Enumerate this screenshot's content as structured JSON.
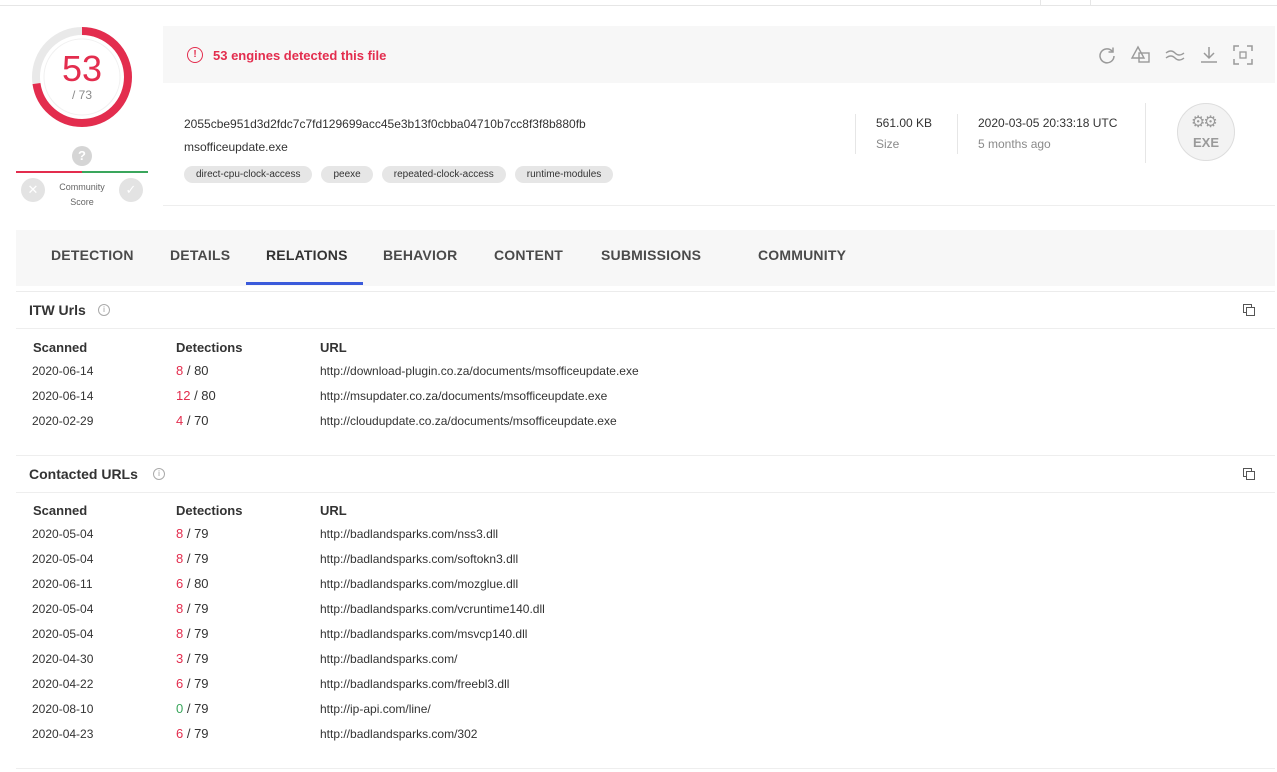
{
  "score": {
    "detected": "53",
    "total": "/ 73",
    "ring_fraction": 0.726,
    "color": "#e32d4e"
  },
  "community": {
    "question": "?",
    "label_line1": "Community",
    "label_line2": "Score"
  },
  "detection": {
    "message": "53 engines detected this file",
    "alert_symbol": "!"
  },
  "toolbar": {
    "icons": [
      "reanalyze-icon",
      "similar-icon",
      "graph-icon",
      "download-icon",
      "expand-icon"
    ]
  },
  "file": {
    "hash": "2055cbe951d3d2fdc7c7fd129699acc45e3b13f0cbba04710b7cc8f3f8b880fb",
    "name": "msofficeupdate.exe",
    "tags": [
      "direct-cpu-clock-access",
      "peexe",
      "repeated-clock-access",
      "runtime-modules"
    ],
    "size_value": "561.00 KB",
    "size_label": "Size",
    "date_value": "2020-03-05 20:33:18 UTC",
    "date_label": "5 months ago",
    "type_icon_text": "EXE"
  },
  "tabs": [
    "DETECTION",
    "DETAILS",
    "RELATIONS",
    "BEHAVIOR",
    "CONTENT",
    "SUBMISSIONS",
    "COMMUNITY"
  ],
  "active_tab": "RELATIONS",
  "itw": {
    "title": "ITW Urls",
    "headers": {
      "scanned": "Scanned",
      "detections": "Detections",
      "url": "URL"
    },
    "rows": [
      {
        "scanned": "2020-06-14",
        "pos": "8",
        "total": "/ 80",
        "url": "http://download-plugin.co.za/documents/msofficeupdate.exe"
      },
      {
        "scanned": "2020-06-14",
        "pos": "12",
        "total": "/ 80",
        "url": "http://msupdater.co.za/documents/msofficeupdate.exe"
      },
      {
        "scanned": "2020-02-29",
        "pos": "4",
        "total": "/ 70",
        "url": "http://cloudupdate.co.za/documents/msofficeupdate.exe"
      }
    ]
  },
  "contacted": {
    "title": "Contacted URLs",
    "headers": {
      "scanned": "Scanned",
      "detections": "Detections",
      "url": "URL"
    },
    "rows": [
      {
        "scanned": "2020-05-04",
        "pos": "8",
        "total": "/ 79",
        "url": "http://badlandsparks.com/nss3.dll"
      },
      {
        "scanned": "2020-05-04",
        "pos": "8",
        "total": "/ 79",
        "url": "http://badlandsparks.com/softokn3.dll"
      },
      {
        "scanned": "2020-06-11",
        "pos": "6",
        "total": "/ 80",
        "url": "http://badlandsparks.com/mozglue.dll"
      },
      {
        "scanned": "2020-05-04",
        "pos": "8",
        "total": "/ 79",
        "url": "http://badlandsparks.com/vcruntime140.dll"
      },
      {
        "scanned": "2020-05-04",
        "pos": "8",
        "total": "/ 79",
        "url": "http://badlandsparks.com/msvcp140.dll"
      },
      {
        "scanned": "2020-04-30",
        "pos": "3",
        "total": "/ 79",
        "url": "http://badlandsparks.com/"
      },
      {
        "scanned": "2020-04-22",
        "pos": "6",
        "total": "/ 79",
        "url": "http://badlandsparks.com/freebl3.dll"
      },
      {
        "scanned": "2020-08-10",
        "pos": "0",
        "total": "/ 79",
        "url": "http://ip-api.com/line/"
      },
      {
        "scanned": "2020-04-23",
        "pos": "6",
        "total": "/ 79",
        "url": "http://badlandsparks.com/302"
      }
    ]
  },
  "colors": {
    "malicious": "#e32d4e",
    "clean": "#3aa65c",
    "accent": "#3b5bdb"
  }
}
